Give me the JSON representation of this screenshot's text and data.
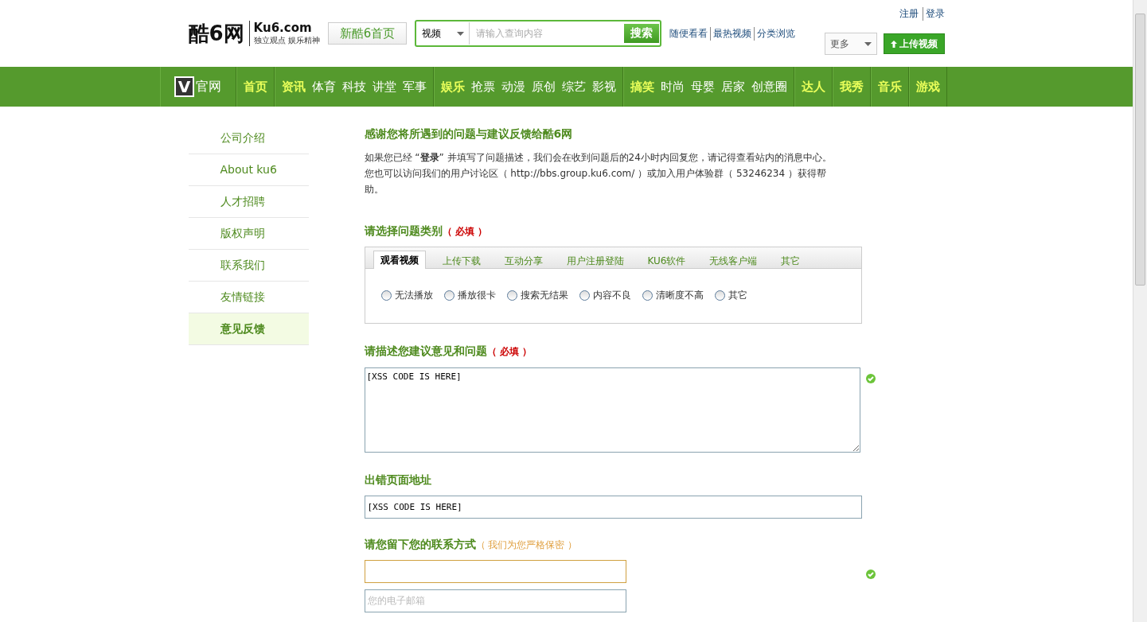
{
  "header": {
    "logo": {
      "name": "酷6网",
      "domain": "Ku6.com",
      "slogan": "独立观点 娱乐精神"
    },
    "home_button": "新酷6首页",
    "search": {
      "category": "视频",
      "placeholder": "请输入查询内容",
      "button": "搜索"
    },
    "quick_links": [
      "随便看看",
      "最热视频",
      "分类浏览"
    ],
    "account_links": [
      "注册",
      "登录"
    ],
    "more_button": "更多",
    "upload_button": "上传视频"
  },
  "nav": {
    "brand": {
      "mark": "V",
      "label": "官网"
    },
    "groups": [
      {
        "items": [
          {
            "label": "首页",
            "highlight": true
          }
        ]
      },
      {
        "items": [
          {
            "label": "资讯",
            "highlight": true
          },
          {
            "label": "体育",
            "highlight": false
          },
          {
            "label": "科技",
            "highlight": false
          },
          {
            "label": "讲堂",
            "highlight": false
          },
          {
            "label": "军事",
            "highlight": false
          }
        ]
      },
      {
        "items": [
          {
            "label": "娱乐",
            "highlight": true
          },
          {
            "label": "抢票",
            "highlight": false
          },
          {
            "label": "动漫",
            "highlight": false
          },
          {
            "label": "原创",
            "highlight": false
          },
          {
            "label": "综艺",
            "highlight": false
          },
          {
            "label": "影视",
            "highlight": false
          }
        ]
      },
      {
        "items": [
          {
            "label": "搞笑",
            "highlight": true
          },
          {
            "label": "时尚",
            "highlight": false
          },
          {
            "label": "母婴",
            "highlight": false
          },
          {
            "label": "居家",
            "highlight": false
          },
          {
            "label": "创意圈",
            "highlight": false
          }
        ]
      },
      {
        "items": [
          {
            "label": "达人",
            "highlight": true
          }
        ]
      },
      {
        "items": [
          {
            "label": "我秀",
            "highlight": true
          }
        ]
      },
      {
        "items": [
          {
            "label": "音乐",
            "highlight": true
          }
        ]
      },
      {
        "items": [
          {
            "label": "游戏",
            "highlight": true
          }
        ]
      }
    ]
  },
  "sidebar": {
    "items": [
      {
        "label": "公司介绍",
        "selected": false
      },
      {
        "label": "About ku6",
        "selected": false
      },
      {
        "label": "人才招聘",
        "selected": false
      },
      {
        "label": "版权声明",
        "selected": false
      },
      {
        "label": "联系我们",
        "selected": false
      },
      {
        "label": "友情链接",
        "selected": false
      },
      {
        "label": "意见反馈",
        "selected": true
      }
    ]
  },
  "main": {
    "title": "感谢您将所遇到的问题与建议反馈给酷6网",
    "intro": "如果您已经 “**登录**” 并填写了问题描述，我们会在收到问题后的24小时内回复您，请记得查看站内的消息中心。您也可以访问我们的用户讨论区（ http://bbs.group.ku6.com/ ）或加入用户体验群（ 53246234 ）获得帮助。",
    "category": {
      "label": "请选择问题类别",
      "note": "（ 必填 ）",
      "tabs": [
        {
          "label": "观看视频",
          "selected": true
        },
        {
          "label": "上传下载",
          "selected": false
        },
        {
          "label": "互动分享",
          "selected": false
        },
        {
          "label": "用户注册登陆",
          "selected": false
        },
        {
          "label": "KU6软件",
          "selected": false
        },
        {
          "label": "无线客户端",
          "selected": false
        },
        {
          "label": "其它",
          "selected": false
        }
      ],
      "options": [
        {
          "label": "无法播放",
          "checked": false
        },
        {
          "label": "播放很卡",
          "checked": false
        },
        {
          "label": "搜索无结果",
          "checked": false
        },
        {
          "label": "内容不良",
          "checked": false
        },
        {
          "label": "清晰度不高",
          "checked": false
        },
        {
          "label": "其它",
          "checked": false
        }
      ]
    },
    "description": {
      "label": "请描述您建议意见和问题",
      "note": "（ 必填 ）",
      "value": "[XSS CODE IS HERE]",
      "valid": true
    },
    "page_url": {
      "label": "出错页面地址",
      "value": "[XSS CODE IS HERE]"
    },
    "contact": {
      "label": "请您留下您的联系方式",
      "note": "（ 我们为您严格保密 ）",
      "valid": true,
      "fields": [
        {
          "focused": true
        },
        {
          "placeholder": "您的电子邮箱",
          "focused": false
        }
      ]
    }
  }
}
